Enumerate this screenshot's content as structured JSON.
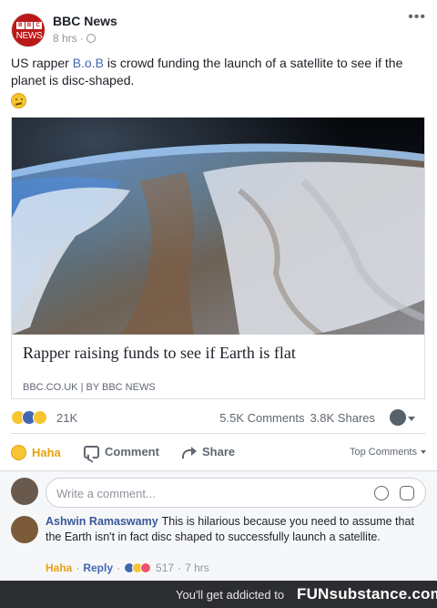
{
  "post": {
    "page_name": "BBC News",
    "logo": {
      "top": "BBC",
      "bottom": "NEWS"
    },
    "time": "8 hrs",
    "separator": "·",
    "more_label": "•••",
    "message_prefix": "US rapper ",
    "message_mention": "B.o.B",
    "message_suffix": " is crowd funding the launch of a satellite to see if the planet is disc-shaped.",
    "emoji": "thinking-face"
  },
  "link_preview": {
    "title": "Rapper raising funds to see if Earth is flat",
    "source": "BBC.CO.UK | BY BBC NEWS",
    "image": "earth-from-orbit"
  },
  "stats": {
    "reaction_count": "21K",
    "comments": "5.5K Comments",
    "shares": "3.8K Shares"
  },
  "actions": {
    "haha": "Haha",
    "comment": "Comment",
    "share": "Share",
    "sort": "Top Comments"
  },
  "composer": {
    "placeholder": "Write a comment..."
  },
  "comment": {
    "author": "Ashwin Ramaswamy",
    "text": "This is hilarious because you need to assume that the Earth isn't in fact disc shaped to successfully launch a satellite.",
    "reaction": "Haha",
    "reply": "Reply",
    "reaction_count": "517",
    "time": "7 hrs"
  },
  "watermark": {
    "text": "You'll get addicted to",
    "brand": "FUNsubstance.com"
  },
  "colors": {
    "link_blue": "#4267b2",
    "haha_yellow": "#e8a211",
    "bbc_red": "#bb1919"
  }
}
